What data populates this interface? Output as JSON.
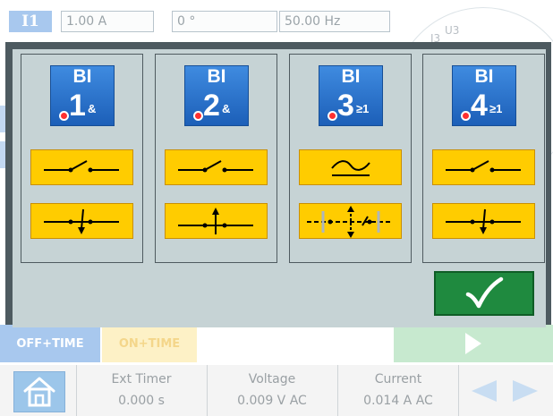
{
  "topbar": {
    "channel": "I1",
    "magnitude": "1.00 A",
    "phase": "0 °",
    "frequency": "50.00 Hz",
    "vector_labels": [
      "U3",
      "I3"
    ]
  },
  "modes": {
    "off_time": "OFF+TIME",
    "on_time": "ON+TIME"
  },
  "status": {
    "ext_timer_label": "Ext Timer",
    "ext_timer_value": "0.000 s",
    "voltage_label": "Voltage",
    "voltage_value": "0.009 V AC",
    "current_label": "Current",
    "current_value": "0.014 A AC"
  },
  "dialog": {
    "inputs": [
      {
        "label": "BI",
        "number": "1",
        "logic": "&",
        "modes": [
          "open-to-close",
          "falling-edge"
        ]
      },
      {
        "label": "BI",
        "number": "2",
        "logic": "&",
        "modes": [
          "open-to-close",
          "rising-edge"
        ]
      },
      {
        "label": "BI",
        "number": "3",
        "logic": "≥1",
        "modes": [
          "analog-threshold",
          "any-edge"
        ]
      },
      {
        "label": "BI",
        "number": "4",
        "logic": "≥1",
        "modes": [
          "open-to-close",
          "falling-edge"
        ]
      }
    ],
    "confirm_icon": "checkmark-icon"
  },
  "colors": {
    "accent_blue": "#2a72cf",
    "tile_yellow": "#ffcc00",
    "confirm_green": "#1f8a3f",
    "dialog_bg": "#c6d3d5",
    "led_red": "#ff3030"
  }
}
